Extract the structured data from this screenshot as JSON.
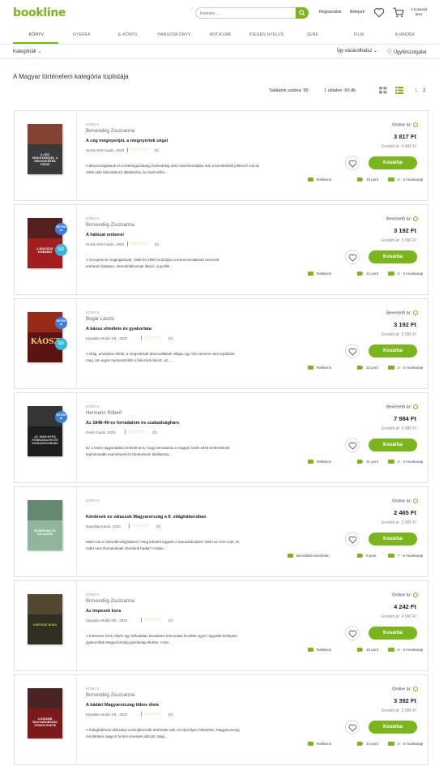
{
  "header": {
    "logo": "bookline",
    "search_placeholder": "Keresés ...",
    "register": "Regisztrálok",
    "login": "Belépek",
    "cart_label": "A kosarad üres"
  },
  "nav": [
    "KÖNYV",
    "GYEREK",
    "E-KÖNYV",
    "HANGOSKÖNYV",
    "ANTIKVÁR",
    "IDEGEN NYELVŰ",
    "ZENE",
    "FILM",
    "AJÁNDÉK"
  ],
  "subbar": {
    "categories": "Kategóriák",
    "how_to_buy": "Így vásárolhatsz",
    "support": "Ügyfélszolgálat"
  },
  "page_title": "A Magyar történelem kategória toplistája",
  "results": {
    "count": "Találatok száma: 99",
    "per_page": "1 oldalon: 60 db",
    "pages": [
      "1",
      "2"
    ]
  },
  "colors": {
    "accent": "#7ab51d",
    "badge_extra": "#3b7fd9",
    "badge_new": "#38b6d9"
  },
  "products": [
    {
      "category": "KÖNYV",
      "author": "Borvendég Zsuzsanna",
      "title": "A cég megnyertjei, a megnyertek cégei",
      "publisher": "HUNLAND Kiadó, 2023",
      "rating_count": "(0)",
      "description_lines": [
        "A titkosszolgálatok és a feketegazdaság évtizedekig tartó összefonódása már a kezdetektől jellemző volt az",
        "1945 után kibontakozó diktatúrára, az évek előre..."
      ],
      "price_type": "Online ár:",
      "price": "3 817 Ft",
      "orig_price": "Eredeti ár: 4 490 Ft",
      "cart_label": "Kosárba",
      "stock": "Raktáron",
      "points": "15 pont",
      "delivery": "2 - 3 munkanap",
      "badges": [],
      "cover": {
        "bg": "#3a3a3a",
        "text": "A CÉG MEGNYERTJEI, A MEGNYERTEK CÉGEI",
        "text_color": "#ffffff",
        "accent": "#b44a2a"
      }
    },
    {
      "category": "KÖNYV",
      "author": "Borvendég Zsuzsanna",
      "title": "A hálózat emberei",
      "publisher": "HUNLAND Kiadó, 2023",
      "rating_count": "(0)",
      "description_lines": [
        "A Szovjetunió megingásával, 1989 és 1990 fordulóján a kommunistáknak nevezett",
        "emberek hatalara, demokratikusnak látszó, új politik..."
      ],
      "price_type": "Bevezető ár:",
      "price": "3 192 Ft",
      "orig_price": "Eredeti ár: 3 990 Ft",
      "cart_label": "Kosárba",
      "stock": "Raktáron",
      "points": "12 pont",
      "delivery": "2 - 3 munkanap",
      "badges": [
        "EXTRA ár",
        "ÚJ"
      ],
      "cover": {
        "bg": "#a01e1e",
        "text": "A HÁLÓZAT EMBEREI",
        "text_color": "#ffffff",
        "accent": "#222222"
      }
    },
    {
      "category": "KÖNYV",
      "author": "Bogár László",
      "title": "A káosz elmélete és gyakorlata",
      "publisher": "Kárpátia Stúdió Kft., 2022",
      "rating_count": "(0)",
      "description_lines": [
        "A világ, amelyben élünk, a megvalósult abszurditások világa, így már semmin nem lepődünk",
        "meg, ám egyre nyomasztóbb a fokozódó káosz, az, ..."
      ],
      "price_type": "Bevezető ár:",
      "price": "3 192 Ft",
      "orig_price": "Eredeti ár: 3 990 Ft",
      "cart_label": "Kosárba",
      "stock": "Raktáron",
      "points": "12 pont",
      "delivery": "2 - 3 munkanap",
      "badges": [
        "EXTRA ár",
        "ÚJ"
      ],
      "cover": {
        "bg": "#5a1414",
        "text": "KÁOSZ",
        "text_color": "#f0d070",
        "accent": "#c23a1a"
      }
    },
    {
      "category": "KÖNYV",
      "author": "Hermann Róbert",
      "title": "Az 1848-49-es forradalom és szabadságharc",
      "publisher": "Osiris Kiadó, 2022",
      "rating_count": "(0)",
      "description_lines": [
        "Ez a kötet nagyszabású kísérlet arra, hogy bemutassa a magyar 1848-1849 történetének",
        "legfontosabb eseményeit és törekvéseit, felvillantsa..."
      ],
      "price_type": "Bevezető ár:",
      "price": "7 984 Ft",
      "orig_price": "Eredeti ár: 9 980 Ft",
      "cart_label": "Kosárba",
      "stock": "Raktáron",
      "points": "31 pont",
      "delivery": "2 - 3 munkanap",
      "badges": [
        "EXTRA ár"
      ],
      "cover": {
        "bg": "#1e1e1e",
        "text": "AZ 1848-49-ES FORRADALOM ÉS SZABADSÁGHARC",
        "text_color": "#dddddd",
        "accent": "#444444"
      }
    },
    {
      "category": "KÖNYV",
      "author": "",
      "title": "Kérdések és válaszok Magyarország a II. világháborúban",
      "publisher": "Napvilág Kiadó, 2023",
      "rating_count": "(0)",
      "description_lines": [
        "Miért volt a második világháború? Meg lehetett tagadni a katonáskodást? Miért az USA-nak, és",
        "miért nem Romániának üzentünk hadat? A béke ..."
      ],
      "price_type": "Online ár:",
      "price": "2 465 Ft",
      "orig_price": "Eredeti ár: 2 900 Ft",
      "cart_label": "Kosárba",
      "stock": "Beszállítói készleten",
      "points": "9 pont",
      "delivery": "7 - 9 munkanap",
      "badges": [],
      "cover": {
        "bg": "#8fb59a",
        "text": "KÉRDÉSEK ÉS VÁLASZOK",
        "text_color": "#ffffff",
        "accent": "#4a6a55"
      }
    },
    {
      "category": "KÖNYV",
      "author": "Borvendég Zsuzsanna",
      "title": "Az impexek kora",
      "publisher": "Kárpátia Stúdió Kft., 2022",
      "rating_count": "(0)",
      "description_lines": [
        "A hetvenes évek elején egy láthatatlan birodalom körvonalai kezdtek egyre nagyobb befolyást",
        "gyakoroltak Magyarország gazdasági életére. A kot..."
      ],
      "price_type": "Online ár:",
      "price": "4 242 Ft",
      "orig_price": "Eredeti ár: 4 990 Ft",
      "cart_label": "Kosárba",
      "stock": "Raktáron",
      "points": "16 pont",
      "delivery": "2 - 3 munkanap",
      "badges": [],
      "cover": {
        "bg": "#2f2f22",
        "text": "IMPEXEK KORA",
        "text_color": "#e8b84a",
        "accent": "#6a5a3a"
      }
    },
    {
      "category": "KÖNYV",
      "author": "Borvendég Zsuzsanna",
      "title": "A kádári Magyarország titkos élete",
      "publisher": "Kárpátia Stúdió Kft., 2023",
      "rating_count": "(0)",
      "description_lines": [
        "A hidegháborús időszaka a kémjátszmák történelte volt, és bármilyen hihetetlen, Magyarország",
        "mindebben nagyon fontos szerepet játszott. Mag..."
      ],
      "price_type": "Online ár:",
      "price": "3 392 Ft",
      "orig_price": "Eredeti ár: 3 990 Ft",
      "cart_label": "Kosárba",
      "stock": "Raktáron",
      "points": "13 pont",
      "delivery": "2 - 3 munkanap",
      "badges": [],
      "cover": {
        "bg": "#7a1a1a",
        "text": "A KÁDÁRI MAGYARORSZÁG TITKOS ÉLETE",
        "text_color": "#ffffff",
        "accent": "#2a2a2a"
      }
    }
  ]
}
